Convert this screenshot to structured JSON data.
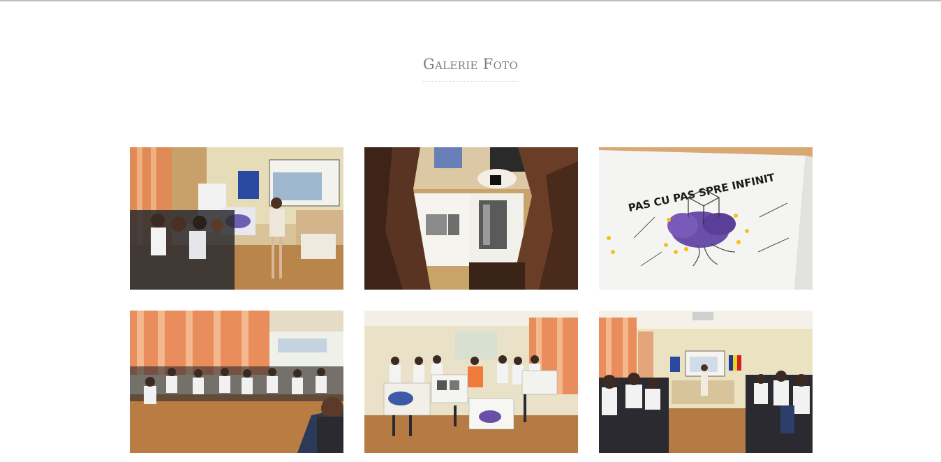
{
  "page": {
    "title": "Galerie Foto"
  },
  "gallery": {
    "photos": [
      {
        "icon": "classroom-presentation-photo",
        "banner_text": ""
      },
      {
        "icon": "book-reading-photo",
        "banner_text": ""
      },
      {
        "icon": "banner-photo",
        "banner_text": "PAS CU PAS SPRE INFINIT"
      },
      {
        "icon": "students-group-photo",
        "banner_text": ""
      },
      {
        "icon": "students-with-banners-photo",
        "banner_text": ""
      },
      {
        "icon": "auditorium-photo",
        "banner_text": ""
      }
    ]
  },
  "colors": {
    "title": "#7d7d7d",
    "top_rule": "#bdbdbd",
    "background": "#ffffff"
  }
}
